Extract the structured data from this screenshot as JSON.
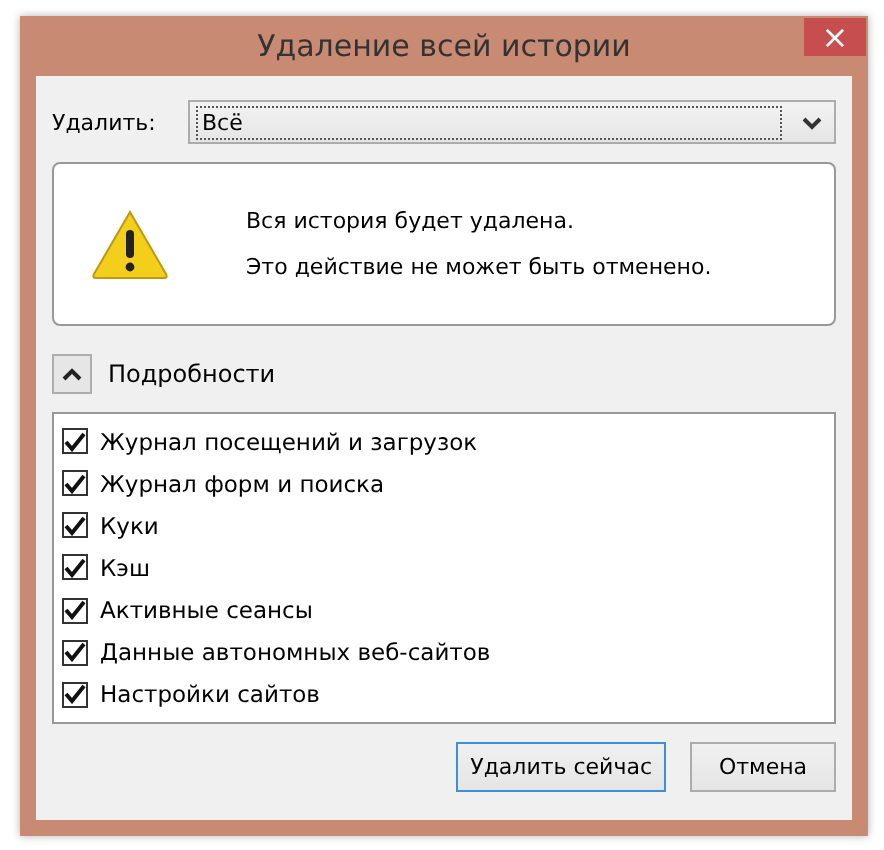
{
  "window": {
    "title": "Удаление всей истории",
    "close": "×"
  },
  "range": {
    "label": "Удалить:",
    "value": "Всё"
  },
  "warning": {
    "lines": [
      "Вся история будет удалена.",
      "Это действие не может быть отменено."
    ]
  },
  "details": {
    "label": "Подробности",
    "expanded": true
  },
  "items": [
    {
      "label": "Журнал посещений и загрузок",
      "checked": true
    },
    {
      "label": "Журнал форм и поиска",
      "checked": true
    },
    {
      "label": "Куки",
      "checked": true
    },
    {
      "label": "Кэш",
      "checked": true
    },
    {
      "label": "Активные сеансы",
      "checked": true
    },
    {
      "label": "Данные автономных веб-сайтов",
      "checked": true
    },
    {
      "label": "Настройки сайтов",
      "checked": true
    }
  ],
  "buttons": [
    {
      "label": "Удалить сейчас",
      "selected": true
    },
    {
      "label": "Отмена",
      "selected": false
    }
  ]
}
